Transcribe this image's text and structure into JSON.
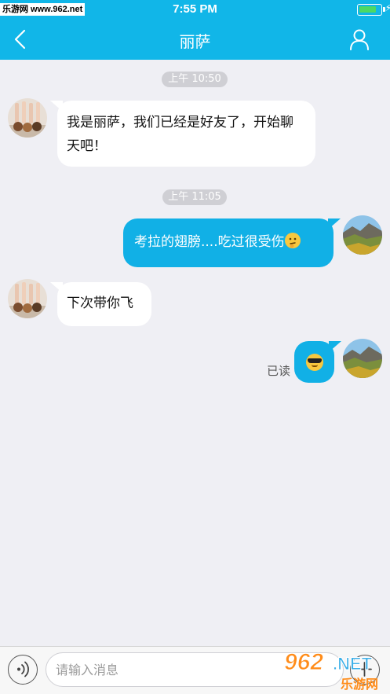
{
  "status_bar": {
    "watermark": "乐游网 www.962.net",
    "time": "7:55 PM",
    "battery_level": 0.85,
    "battery_color": "#4cd964"
  },
  "nav": {
    "title": "丽萨",
    "back_icon": "chevron-left-icon",
    "profile_icon": "person-icon",
    "background": "#11b6e8"
  },
  "messages": [
    {
      "type": "timestamp",
      "text": "上午 10:50"
    },
    {
      "type": "incoming",
      "text": "我是丽萨，我们已经是好友了，开始聊天吧！"
    },
    {
      "type": "timestamp",
      "text": "上午 11:05"
    },
    {
      "type": "outgoing",
      "text": "考拉的翅膀....吃过很受伤",
      "emoji": "thinking-face-icon"
    },
    {
      "type": "incoming",
      "text": "下次带你飞"
    },
    {
      "type": "outgoing",
      "emoji": "sunglasses-face-icon",
      "status": "已读"
    }
  ],
  "input": {
    "placeholder": "请输入消息",
    "voice_icon": "voice-icon",
    "plus_icon": "plus-icon"
  },
  "watermark_bottom": {
    "number": "962",
    "net": ".NET",
    "site": "乐游网"
  }
}
